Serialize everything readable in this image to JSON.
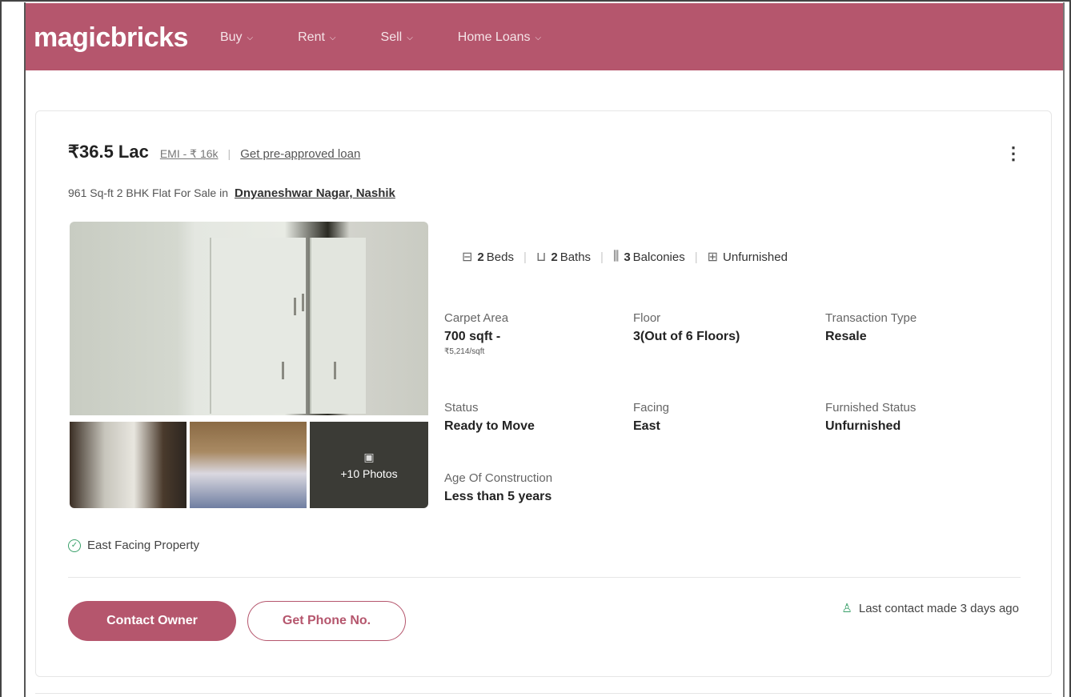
{
  "brand": {
    "logo": "magicbricks",
    "accent": "#b5566d"
  },
  "nav": [
    {
      "label": "Buy"
    },
    {
      "label": "Rent"
    },
    {
      "label": "Sell"
    },
    {
      "label": "Home Loans"
    }
  ],
  "listing": {
    "price": "₹36.5 Lac",
    "emi": "EMI - ₹ 16k",
    "separator": "|",
    "loan_link": "Get pre-approved loan",
    "subtitle": "961 Sq-ft 2 BHK Flat For Sale in",
    "locality": "Dnyaneshwar Nagar, Nashik",
    "more_photos": "+10 Photos",
    "amenities": [
      {
        "value": "2",
        "label": "Beds",
        "icon": "bed-icon"
      },
      {
        "value": "2",
        "label": "Baths",
        "icon": "bath-icon"
      },
      {
        "value": "3",
        "label": "Balconies",
        "icon": "balcony-icon"
      },
      {
        "value": "",
        "label": "Unfurnished",
        "icon": "furniture-icon"
      }
    ],
    "details": {
      "carpet_area": {
        "label": "Carpet Area",
        "value": "700 sqft -",
        "sub": "₹5,214/sqft"
      },
      "floor": {
        "label": "Floor",
        "value": "3(Out of 6 Floors)"
      },
      "transaction": {
        "label": "Transaction Type",
        "value": "Resale"
      },
      "status": {
        "label": "Status",
        "value": "Ready to Move"
      },
      "facing": {
        "label": "Facing",
        "value": "East"
      },
      "furnished": {
        "label": "Furnished Status",
        "value": "Unfurnished"
      },
      "age": {
        "label": "Age Of Construction",
        "value": "Less than 5 years"
      }
    },
    "badge": "East Facing Property",
    "contact_button": "Contact Owner",
    "phone_button": "Get Phone No.",
    "last_contact": "Last contact made 3 days ago"
  }
}
